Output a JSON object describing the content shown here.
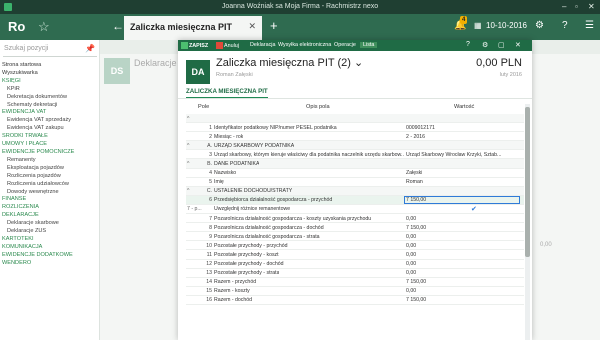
{
  "window": {
    "title": "Joanna Woźniak sa Moja Firma - Rachmistrz nexo"
  },
  "header": {
    "logo": "Ro",
    "doc_tab": "Zaliczka miesięczna PIT",
    "notif_count": "4",
    "date": "10-10-2016"
  },
  "sidebar": {
    "search_placeholder": "Szukaj pozycji",
    "items": [
      {
        "label": "Strona startowa",
        "level": 0
      },
      {
        "label": "Wyszukiwarka",
        "level": 0
      },
      {
        "label": "KSIĘGI",
        "level": "sec"
      },
      {
        "label": "KPiR",
        "level": 1
      },
      {
        "label": "Dekretacja dokumentów",
        "level": 1
      },
      {
        "label": "Schematy dekretacji",
        "level": 1
      },
      {
        "label": "EWIDENCJA VAT",
        "level": "sec"
      },
      {
        "label": "Ewidencja VAT sprzedaży",
        "level": 1
      },
      {
        "label": "Ewidencja VAT zakupu",
        "level": 1
      },
      {
        "label": "ŚRODKI TRWAŁE",
        "level": "sec"
      },
      {
        "label": "UMOWY I PŁACE",
        "level": "sec"
      },
      {
        "label": "EWIDENCJE POMOCNICZE",
        "level": "sec"
      },
      {
        "label": "Remanenty",
        "level": 1
      },
      {
        "label": "Eksploatacja pojazdów",
        "level": 1
      },
      {
        "label": "Rozliczenia pojazdów",
        "level": 1
      },
      {
        "label": "Rozliczenia udziałowców",
        "level": 1
      },
      {
        "label": "Dowody wewnętrzne",
        "level": 1
      },
      {
        "label": "FINANSE",
        "level": "sec"
      },
      {
        "label": "ROZLICZENIA",
        "level": "sec"
      },
      {
        "label": "DEKLARACJE",
        "level": "sec"
      },
      {
        "label": "Deklaracje skarbowe",
        "level": 1
      },
      {
        "label": "Deklaracje ZUS",
        "level": 1
      },
      {
        "label": "KARTOTEKI",
        "level": "sec"
      },
      {
        "label": "KOMUNIKACJA",
        "level": "sec"
      },
      {
        "label": "EWIDENCJE DODATKOWE",
        "level": "sec"
      },
      {
        "label": "WENDERO",
        "level": "sec"
      }
    ]
  },
  "background": {
    "icon_text": "DS",
    "title": "Deklaracje",
    "kwota": "0,00"
  },
  "dialog": {
    "toolbar": {
      "save": "ZAPISZ",
      "cancel": "Anuluj",
      "dekl": "Deklaracja",
      "send": "Wysyłka elektroniczna",
      "ops": "Operacje",
      "list": "Lista"
    },
    "icon_text": "DA",
    "title": "Zaliczka miesięczna PIT (2)",
    "subtitle": "Roman Załęski",
    "amount": "0,00 PLN",
    "month": "luty 2016",
    "tab": "ZALICZKA MIESIĘCZNA PIT",
    "columns": {
      "pole": "Pole",
      "opis": "Opis pola",
      "wartosc": "Wartość"
    },
    "rows": [
      {
        "type": "sec",
        "pref": "^",
        "num": "",
        "label": "",
        "value": ""
      },
      {
        "type": "row",
        "pref": "",
        "num": "1",
        "label": "Identyfikator podatkowy NIP/numer PESEL podatnika",
        "value": "0009012171"
      },
      {
        "type": "row",
        "pref": "",
        "num": "2",
        "label": "Miesiąc - rok",
        "value": "2 - 2016"
      },
      {
        "type": "sec",
        "pref": "^",
        "num": "A.",
        "label": "URZĄD SKARBOWY PODATNIKA",
        "value": ""
      },
      {
        "type": "row",
        "pref": "",
        "num": "3",
        "label": "Urząd skarbowy, którym kieruje właściwy dla podatnika naczelnik urzędu skarbow...",
        "value": "Urząd Skarbowy Wrocław Krzyki, Sztab..."
      },
      {
        "type": "sec",
        "pref": "^",
        "num": "B.",
        "label": "DANE PODATNIKA",
        "value": ""
      },
      {
        "type": "row",
        "pref": "",
        "num": "4",
        "label": "Nazwisko",
        "value": "Załęski"
      },
      {
        "type": "row",
        "pref": "",
        "num": "5",
        "label": "Imię",
        "value": "Roman"
      },
      {
        "type": "sec",
        "pref": "^",
        "num": "C.",
        "label": "USTALENIE DOCHODU/STRATY",
        "value": ""
      },
      {
        "type": "edit",
        "pref": "",
        "num": "6",
        "label": "Przedsiębiorca działalność gospodarcza - przychód",
        "value": "7 150,00"
      },
      {
        "type": "check",
        "pref": "7 - p...",
        "num": "",
        "label": "Uwzględnij różnice remanentowe",
        "value": "✔"
      },
      {
        "type": "row",
        "pref": "",
        "num": "7",
        "label": "Pozarolnicza działalność gospodarcza - koszty uzyskania przychodu",
        "value": "0,00"
      },
      {
        "type": "row",
        "pref": "",
        "num": "8",
        "label": "Pozarolnicza działalność gospodarcza - dochód",
        "value": "7 150,00"
      },
      {
        "type": "row",
        "pref": "",
        "num": "9",
        "label": "Pozarolnicza działalność gospodarcza - strata",
        "value": "0,00"
      },
      {
        "type": "row",
        "pref": "",
        "num": "10",
        "label": "Pozostałe przychody - przychód",
        "value": "0,00"
      },
      {
        "type": "row",
        "pref": "",
        "num": "11",
        "label": "Pozostałe przychody - koszt",
        "value": "0,00"
      },
      {
        "type": "row",
        "pref": "",
        "num": "12",
        "label": "Pozostałe przychody - dochód",
        "value": "0,00"
      },
      {
        "type": "row",
        "pref": "",
        "num": "13",
        "label": "Pozostałe przychody - strata",
        "value": "0,00"
      },
      {
        "type": "row",
        "pref": "",
        "num": "14",
        "label": "Razem - przychód",
        "value": "7 150,00"
      },
      {
        "type": "row",
        "pref": "",
        "num": "15",
        "label": "Razem - koszty",
        "value": "0,00"
      },
      {
        "type": "row",
        "pref": "",
        "num": "16",
        "label": "Razem - dochód",
        "value": "7 150,00"
      }
    ]
  },
  "colors": {
    "accent": "#2f6b50",
    "dialog_toolbar": "#1f6b45",
    "section": "#2b8a4e",
    "edit_border": "#2f7bd8"
  }
}
